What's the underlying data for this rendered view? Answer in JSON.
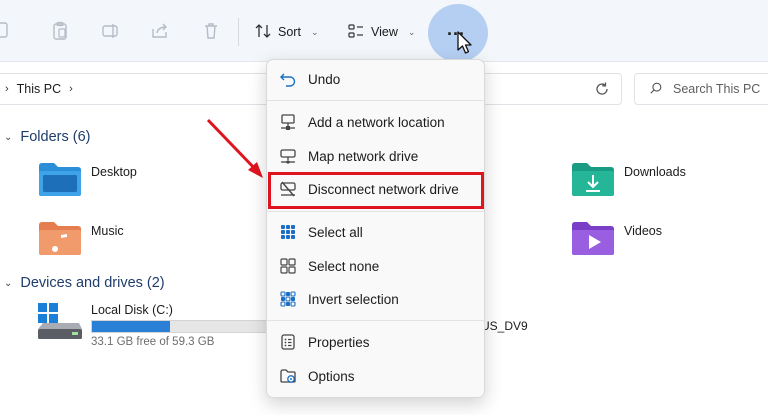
{
  "toolbar": {
    "sort_label": "Sort",
    "view_label": "View",
    "more_label": "..."
  },
  "address": {
    "path": [
      "This PC"
    ],
    "search_placeholder": "Search This PC"
  },
  "folders": {
    "header": "Folders (6)",
    "items": [
      {
        "label": "Desktop"
      },
      {
        "label": "Downloads"
      },
      {
        "label": "Music"
      },
      {
        "label": "Videos"
      }
    ]
  },
  "drives": {
    "header": "Devices and drives (2)",
    "local": {
      "name": "Local Disk (C:)",
      "free_text": "33.1 GB free of 59.3 GB",
      "used_fraction": 0.44
    },
    "dvd_label": "US_DV9"
  },
  "menu": {
    "items": [
      {
        "label": "Undo"
      },
      {
        "label": "Add a network location"
      },
      {
        "label": "Map network drive"
      },
      {
        "label": "Disconnect network drive"
      },
      {
        "label": "Select all"
      },
      {
        "label": "Select none"
      },
      {
        "label": "Invert selection"
      },
      {
        "label": "Properties"
      },
      {
        "label": "Options"
      }
    ]
  },
  "colors": {
    "accent": "#2a80d7",
    "annotation": "#e0141e",
    "highlight_circle": "#82afeb"
  }
}
